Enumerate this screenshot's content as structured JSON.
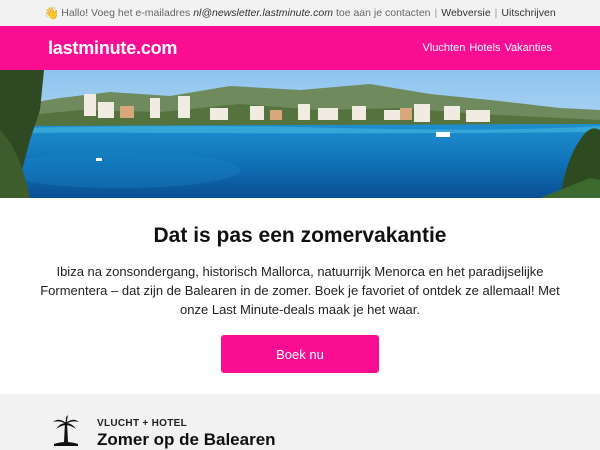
{
  "topbar": {
    "wave_emoji": "👋",
    "text_before": "Hallo! Voeg het e-mailadres",
    "email": "nl@newsletter.lastminute.com",
    "text_after": "toe aan je contacten",
    "separator": "|",
    "webversion_label": "Webversie",
    "unsubscribe_label": "Uitschrijven"
  },
  "header": {
    "logo": "lastminute.com",
    "nav": [
      "Vluchten",
      "Hotels",
      "Vakanties"
    ],
    "brand_color": "#f80d93"
  },
  "hero": {
    "icon": "beach-photo"
  },
  "main": {
    "headline": "Dat is pas een zomervakantie",
    "intro": "Ibiza na zonsondergang, historisch Mallorca, natuurrijk Menorca en het paradijselijke Formentera – dat zijn de Balearen in de zomer. Boek je favoriet of ontdek ze allemaal! Met onze Last Minute-deals maak je het waar.",
    "cta_label": "Boek nu"
  },
  "offer": {
    "icon": "palm-tree-icon",
    "kicker": "VLUCHT + HOTEL",
    "title": "Zomer op de Balearen"
  }
}
